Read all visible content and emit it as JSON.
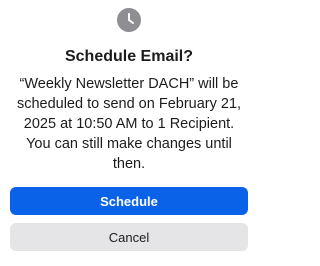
{
  "dialog": {
    "icon": "clock-icon",
    "title": "Schedule Email?",
    "message": "“Weekly Newsletter DACH” will be scheduled to send on February 21, 2025 at 10:50 AM to 1 Recipient. You can still make changes until then.",
    "primary_button": "Schedule",
    "secondary_button": "Cancel"
  },
  "colors": {
    "primary": "#0a62e8",
    "secondary_bg": "#e5e5e7",
    "icon_bg": "#8e8e93"
  }
}
